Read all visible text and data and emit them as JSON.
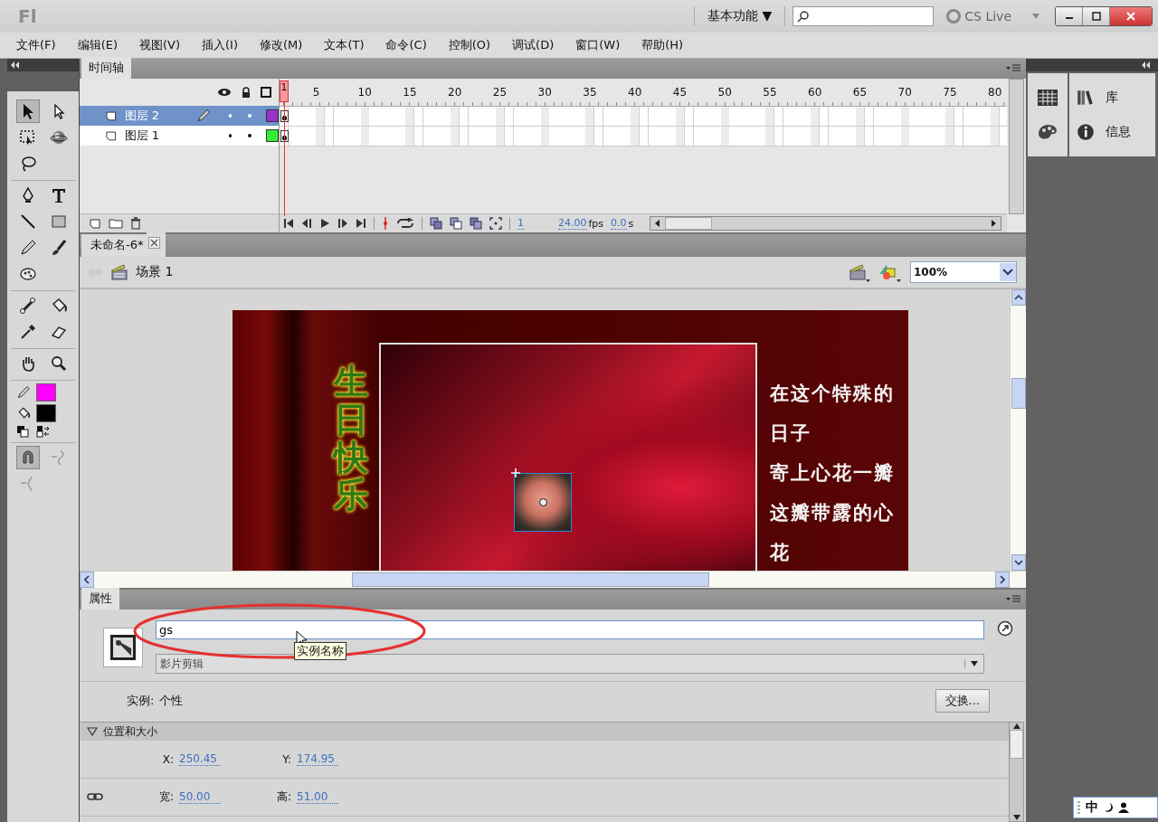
{
  "app": {
    "logo": "Fl",
    "workspace": "基本功能",
    "workspace_caret": "▼",
    "cs_live": "CS Live"
  },
  "menu": [
    "文件(F)",
    "编辑(E)",
    "视图(V)",
    "插入(I)",
    "修改(M)",
    "文本(T)",
    "命令(C)",
    "控制(O)",
    "调试(D)",
    "窗口(W)",
    "帮助(H)"
  ],
  "tool_groups": [
    [
      [
        {
          "kind": "arrow",
          "selected": true
        },
        {
          "kind": "subselect",
          "selected": false
        }
      ],
      [
        {
          "kind": "transform",
          "selected": false
        },
        {
          "kind": "rotate3d",
          "selected": false
        }
      ],
      [
        {
          "kind": "lasso",
          "selected": false
        }
      ]
    ],
    [
      [
        {
          "kind": "pen",
          "selected": false
        },
        {
          "kind": "text",
          "selected": false
        }
      ],
      [
        {
          "kind": "line",
          "selected": false
        },
        {
          "kind": "rect",
          "selected": false
        }
      ],
      [
        {
          "kind": "pencil",
          "selected": false
        },
        {
          "kind": "brush",
          "selected": false
        }
      ],
      [
        {
          "kind": "deco",
          "selected": false
        }
      ]
    ],
    [
      [
        {
          "kind": "bone",
          "selected": false
        },
        {
          "kind": "bucket",
          "selected": false
        }
      ],
      [
        {
          "kind": "eyedropper",
          "selected": false
        },
        {
          "kind": "eraser",
          "selected": false
        }
      ]
    ],
    [
      [
        {
          "kind": "hand",
          "selected": false
        },
        {
          "kind": "zoom",
          "selected": false
        }
      ]
    ]
  ],
  "color_swatches": [
    {
      "kind": "stroke",
      "color": "#ff00ff"
    },
    {
      "kind": "fill",
      "color": "#000000"
    }
  ],
  "snap_tools": [
    [
      {
        "kind": "magnet",
        "selected": true
      },
      {
        "kind": "smooth",
        "selected": false
      }
    ],
    [
      {
        "kind": "straighten",
        "selected": false
      }
    ]
  ],
  "timeline": {
    "tab": "时间轴",
    "ruler": [
      "1",
      "5",
      "10",
      "15",
      "20",
      "25",
      "30",
      "35",
      "40",
      "45",
      "50",
      "55",
      "60",
      "65",
      "70",
      "75",
      "80"
    ],
    "layers": [
      {
        "name": "图层 2",
        "selected": true,
        "editing": true,
        "color": "#9933cc"
      },
      {
        "name": "图层 1",
        "selected": false,
        "editing": false,
        "color": "#33ee33"
      }
    ],
    "footer": {
      "frame": "1",
      "fps": "24.00",
      "fps_unit": "fps",
      "time": "0.0",
      "time_unit": "s"
    }
  },
  "right_panels": [
    {
      "label": "库",
      "kind": "library"
    },
    {
      "label": "信息",
      "kind": "info"
    }
  ],
  "document": {
    "tab": "未命名-6*",
    "scene": "场景 1",
    "zoom": "100%"
  },
  "stage": {
    "title": "生日快乐",
    "poem": [
      "在这个特殊的",
      "日子",
      "寄上心花一瓣",
      "这瓣带露的心",
      "花"
    ]
  },
  "properties": {
    "tab": "属性",
    "instance_name": "gs",
    "tooltip": "实例名称",
    "symbol_type": "影片剪辑",
    "instance_label": "实例:",
    "instance_of": "个性",
    "swap_button": "交换...",
    "section": {
      "title": "位置和大小",
      "expanded": true
    },
    "fields": [
      [
        {
          "label": "X:",
          "value": "250.45"
        },
        {
          "label": "Y:",
          "value": "174.95"
        }
      ],
      [
        {
          "label": "宽:",
          "value": "50.00"
        },
        {
          "label": "高:",
          "value": "51.00"
        }
      ]
    ]
  },
  "ime": {
    "mode": "中"
  }
}
